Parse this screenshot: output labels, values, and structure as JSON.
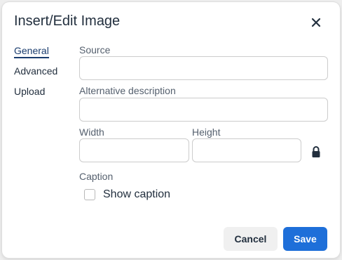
{
  "dialog": {
    "title": "Insert/Edit Image",
    "close_icon": "close-icon"
  },
  "tabs": [
    {
      "label": "General",
      "active": true
    },
    {
      "label": "Advanced",
      "active": false
    },
    {
      "label": "Upload",
      "active": false
    }
  ],
  "fields": {
    "source": {
      "label": "Source",
      "value": ""
    },
    "alt": {
      "label": "Alternative description",
      "value": ""
    },
    "width": {
      "label": "Width",
      "value": ""
    },
    "height": {
      "label": "Height",
      "value": ""
    },
    "caption": {
      "label": "Caption"
    },
    "show_caption": {
      "label": "Show caption",
      "checked": false
    }
  },
  "icons": {
    "lock": "lock-icon"
  },
  "buttons": {
    "cancel": "Cancel",
    "save": "Save"
  },
  "colors": {
    "primary": "#1e6fd9",
    "active_tab": "#1a3c6e"
  }
}
